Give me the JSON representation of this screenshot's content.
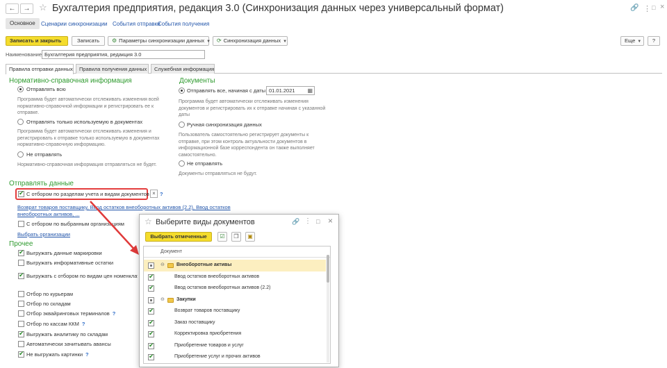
{
  "window": {
    "title": "Бухгалтерия предприятия, редакция 3.0 (Синхронизация данных через универсальный формат)",
    "back": "←",
    "forward": "→",
    "favorite": "☆",
    "link_icon": "🔗",
    "more_icon": "⋮",
    "maximize_icon": "□",
    "close_icon": "×"
  },
  "nav": {
    "main": "Основное",
    "sync_scenarios": "Сценарии синхронизации",
    "send_events": "События отправки",
    "receive_events": "События получения"
  },
  "toolbar": {
    "save_close": "Записать и закрыть",
    "save": "Записать",
    "sync_params": "Параметры синхронизации данных",
    "sync_data": "Синхронизация данных",
    "more": "Еще",
    "help": "?"
  },
  "name_field": {
    "label": "Наименование:",
    "value": "Бухгалтерия предприятия, редакция 3.0"
  },
  "tabs": [
    "Правила отправки данных",
    "Правила получения данных",
    "Служебная информация"
  ],
  "nsi": {
    "title": "Нормативно-справочная информация",
    "send_all": "Отправлять всю",
    "send_all_desc": "Программа будет автоматически отслеживать изменения всей нормативно-справочной информации и регистрировать ее к отправке.",
    "send_used": "Отправлять только используемую в документах",
    "send_used_desc": "Программа будет автоматически отслеживать изменения и регистрировать к отправке только используемую в документах нормативно-справочную информацию.",
    "dont_send": "Не отправлять",
    "dont_send_desc": "Нормативно-справочная информация отправляться не будет."
  },
  "docs": {
    "title": "Документы",
    "send_from": "Отправлять все, начиная с даты",
    "date": "01.01.2021",
    "send_from_desc": "Программа будет автоматически отслеживать изменения документов и регистрировать их к отправке начиная с указанной даты",
    "manual": "Ручная синхронизация данных",
    "manual_desc": "Пользователь самостоятельно регистрирует документы к отправке, при этом контроль актуальности документов в информационной базе корреспондента он также выполняет самостоятельно.",
    "dont_send": "Не отправлять",
    "dont_send_desc": "Документы отправляться не будут."
  },
  "send_data": {
    "title": "Отправлять данные",
    "filter_sections": "С отбором по разделам учета и видам документов",
    "clear": "×",
    "help": "?",
    "doc_link": "Возврат товаров поставщику, Ввод остатков внеоборотных активов (2.2), Ввод остатков внеоборотных активов, ...",
    "filter_orgs": "С отбором по выбранным организациям",
    "choose_orgs": "Выбрать организации"
  },
  "other": {
    "title": "Прочее",
    "items": [
      {
        "label": "Выгружать данные маркировки",
        "checked": true,
        "help": ""
      },
      {
        "label": "Выгружать информативные остатки",
        "checked": false,
        "help": ""
      },
      {
        "label": "Выгружать с отбором по видам цен номенклату",
        "checked": true,
        "help": ""
      },
      {
        "label": "Отбор по курьерам",
        "checked": false,
        "help": ""
      },
      {
        "label": "Отбор по складам",
        "checked": false,
        "help": ""
      },
      {
        "label": "Отбор эквайринговых терминалов",
        "checked": false,
        "help": "?"
      },
      {
        "label": "Отбор по кассам ККМ",
        "checked": false,
        "help": "?"
      },
      {
        "label": "Выгружать аналитику по складам",
        "checked": true,
        "help": ""
      },
      {
        "label": "Автоматически зачитывать авансы",
        "checked": false,
        "help": ""
      },
      {
        "label": "Не выгружать картинки",
        "checked": true,
        "help": "?"
      }
    ]
  },
  "dialog": {
    "title": "Выберите виды документов",
    "select_marked": "Выбрать отмеченные",
    "column": "Документ",
    "rows": [
      {
        "label": "Внеоборотные активы",
        "group": true,
        "checked": false
      },
      {
        "label": "Ввод остатков внеоборотных активов",
        "group": false,
        "checked": true
      },
      {
        "label": "Ввод остатков внеоборотных активов (2.2)",
        "group": false,
        "checked": true
      },
      {
        "label": "Закупки",
        "group": true,
        "checked": false
      },
      {
        "label": "Возврат товаров поставщику",
        "group": false,
        "checked": true
      },
      {
        "label": "Заказ поставщику",
        "group": false,
        "checked": true
      },
      {
        "label": "Корректировка приобретения",
        "group": false,
        "checked": true
      },
      {
        "label": "Приобретение товаров и услуг",
        "group": false,
        "checked": true
      },
      {
        "label": "Приобретение услуг и прочих активов",
        "group": false,
        "checked": true
      }
    ]
  }
}
